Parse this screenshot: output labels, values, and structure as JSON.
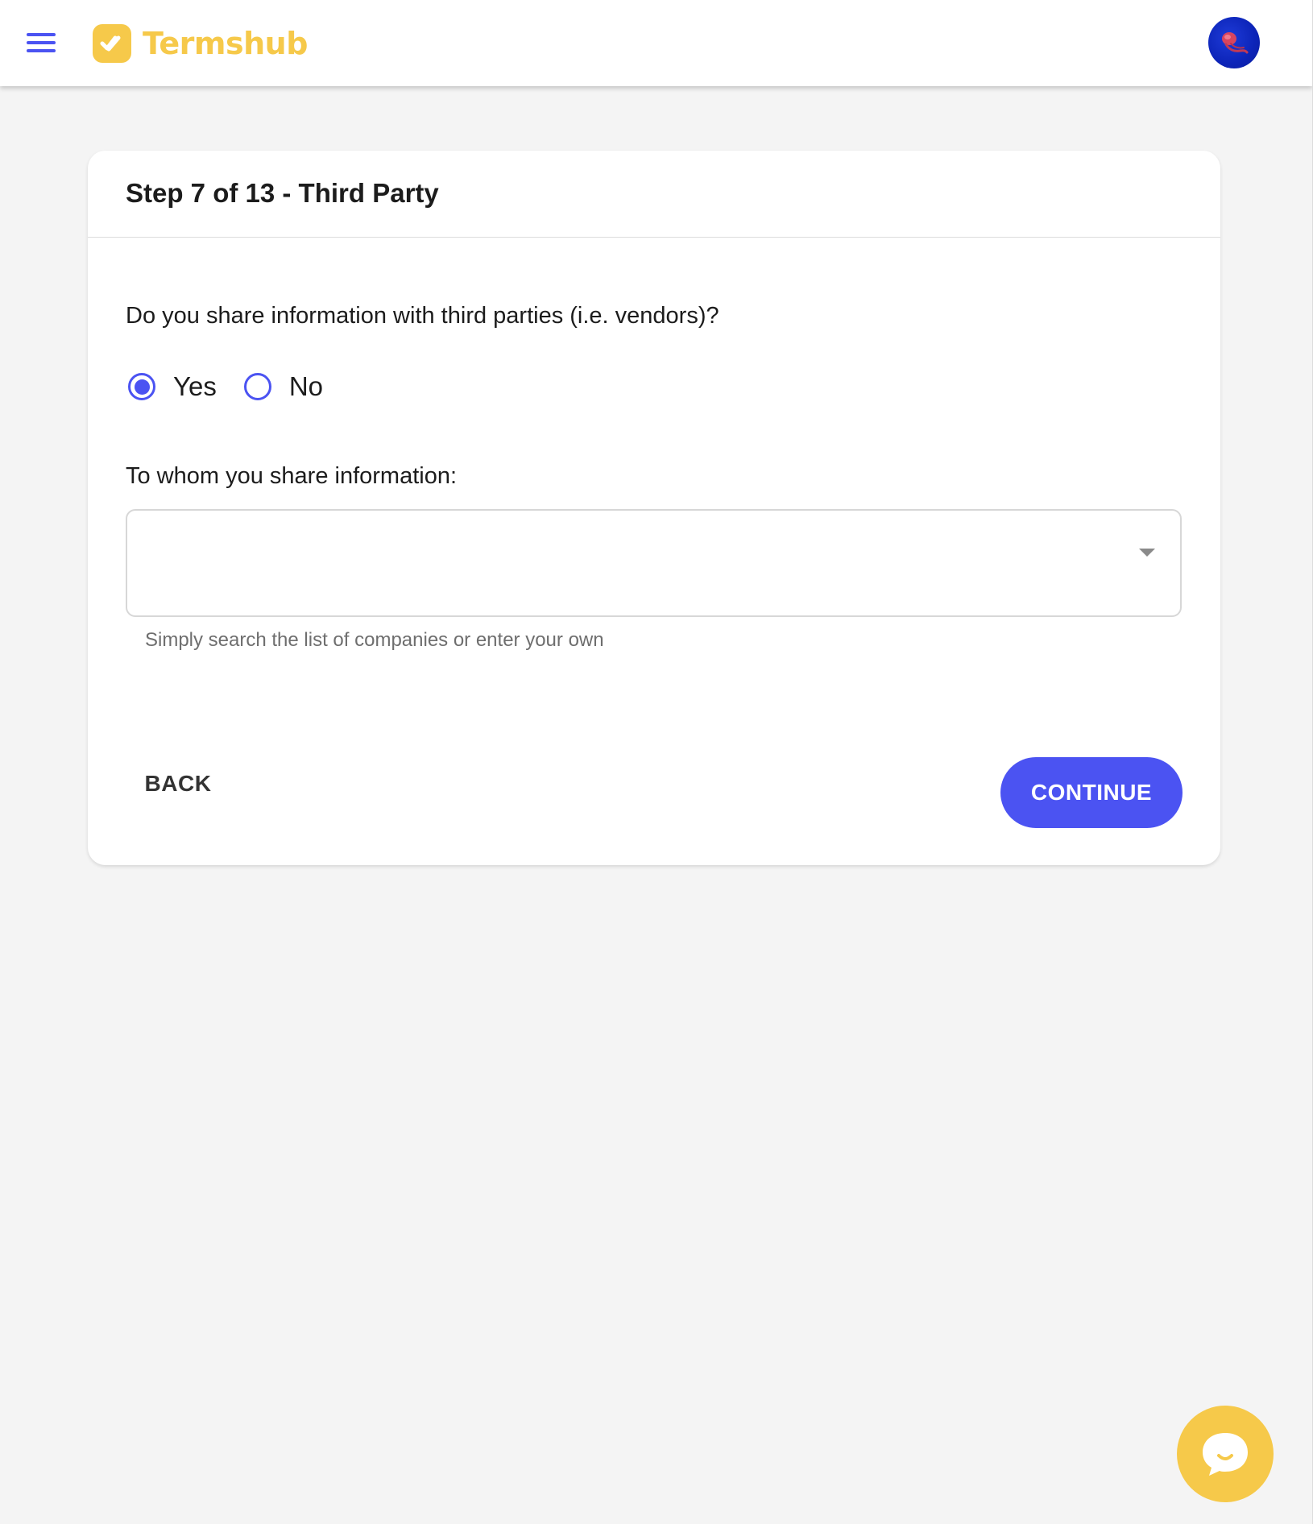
{
  "colors": {
    "accent": "#4b53f2",
    "brand": "#f6c94a",
    "background": "#f4f4f4"
  },
  "header": {
    "menu_icon": "hamburger-menu-icon",
    "logo_icon": "termshub-check-logo-icon",
    "brand_name": "Termshub",
    "avatar_icon": "jellyfish-avatar-icon"
  },
  "card": {
    "title": "Step 7 of 13 - Third Party",
    "question": "Do you share information with third parties (i.e. vendors)?",
    "options": [
      {
        "label": "Yes",
        "selected": true
      },
      {
        "label": "No",
        "selected": false
      }
    ],
    "field_label": "To whom you share information:",
    "field_value": "",
    "field_icon": "chevron-down-icon",
    "helper_text": "Simply search the list of companies or enter your own",
    "back_label": "BACK",
    "continue_label": "CONTINUE"
  },
  "chat": {
    "icon": "chat-bubble-icon"
  }
}
